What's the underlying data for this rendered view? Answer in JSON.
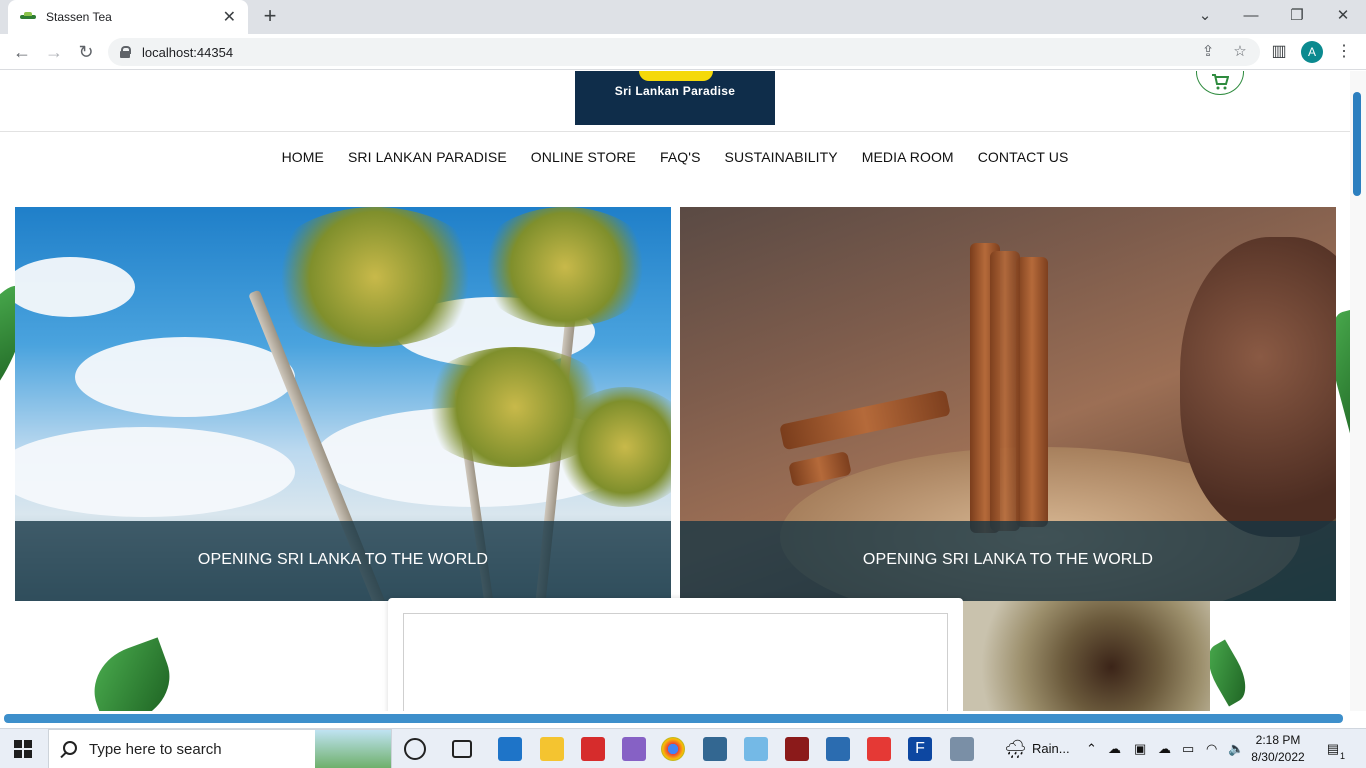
{
  "browser": {
    "tab_title": "Stassen Tea",
    "url": "localhost:44354",
    "profile_initial": "A"
  },
  "site": {
    "logo_text": "Sri Lankan Paradise",
    "nav": [
      "HOME",
      "SRI LANKAN PARADISE",
      "ONLINE STORE",
      "FAQ'S",
      "SUSTAINABILITY",
      "MEDIA ROOM",
      "CONTACT US"
    ],
    "cards": [
      {
        "caption": "OPENING SRI LANKA TO THE WORLD",
        "image": "palm-trees-beach"
      },
      {
        "caption": "OPENING SRI LANKA TO THE WORLD",
        "image": "cinnamon-sticks-spices"
      }
    ],
    "colors": {
      "logo_bg": "#0f2d4a",
      "accent_green": "#2e8b3e",
      "caption_bg": "#143444"
    }
  },
  "taskbar": {
    "search_placeholder": "Type here to search",
    "weather": "Rain...",
    "time": "2:18 PM",
    "date": "8/30/2022",
    "notifications": "1"
  }
}
